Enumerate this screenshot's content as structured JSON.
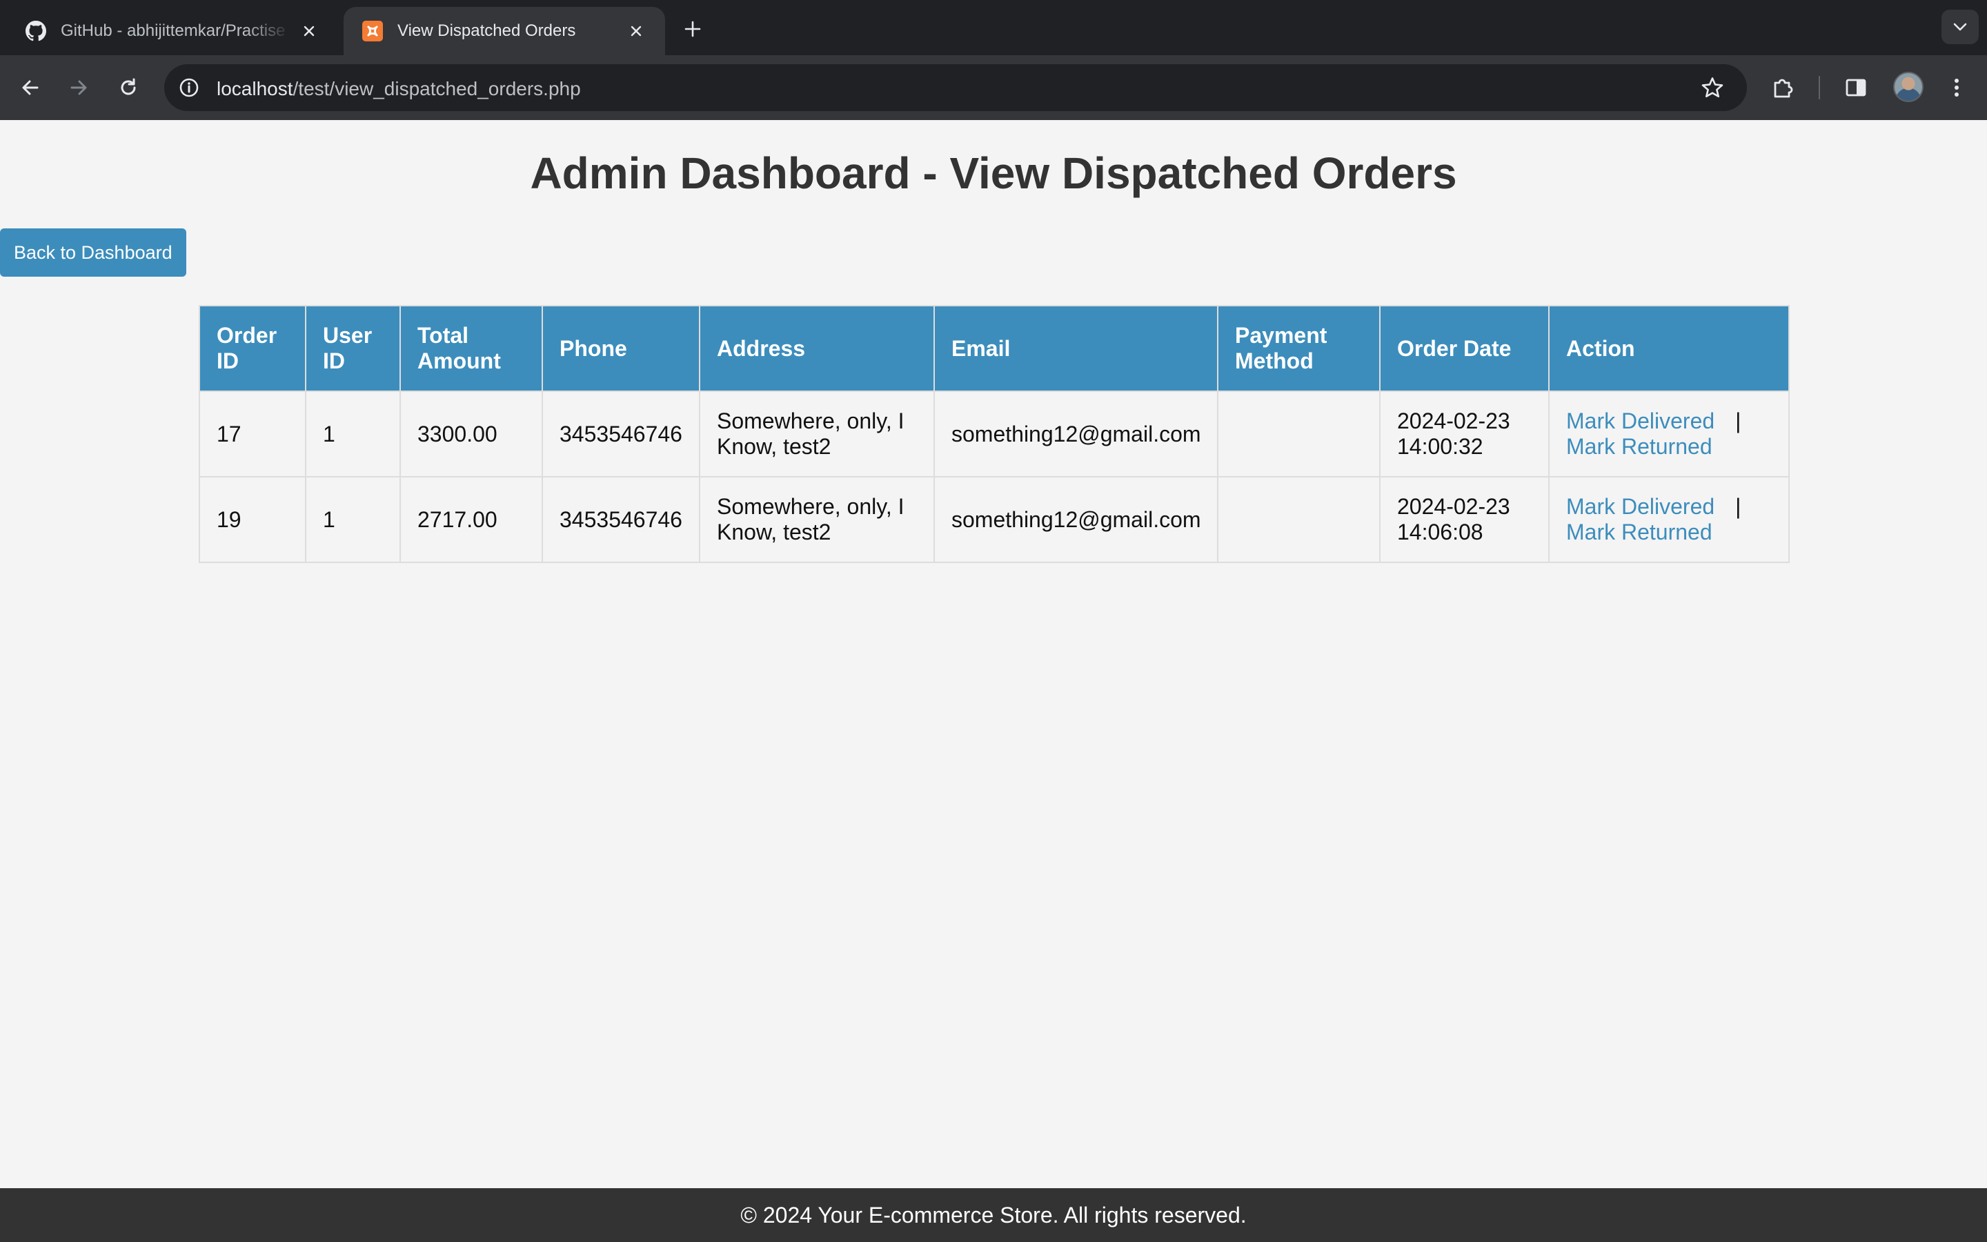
{
  "browser": {
    "tabs": [
      {
        "title": "GitHub - abhijittemkar/Practise",
        "favicon": "github-icon",
        "active": false
      },
      {
        "title": "View Dispatched Orders",
        "favicon": "xampp-icon",
        "active": true
      }
    ],
    "url": {
      "host": "localhost",
      "path": "/test/view_dispatched_orders.php"
    }
  },
  "page": {
    "title": "Admin Dashboard - View Dispatched Orders",
    "back_button": "Back to Dashboard"
  },
  "table": {
    "headers": [
      "Order ID",
      "User ID",
      "Total Amount",
      "Phone",
      "Address",
      "Email",
      "Payment Method",
      "Order Date",
      "Action"
    ],
    "rows": [
      {
        "order_id": "17",
        "user_id": "1",
        "total_amount": "3300.00",
        "phone": "3453546746",
        "address": "Somewhere, only, I Know, test2",
        "email": "something12@gmail.com",
        "payment_method": "",
        "order_date": "2024-02-23 14:00:32",
        "actions": {
          "delivered": "Mark Delivered",
          "separator": "|",
          "returned": "Mark Returned"
        }
      },
      {
        "order_id": "19",
        "user_id": "1",
        "total_amount": "2717.00",
        "phone": "3453546746",
        "address": "Somewhere, only, I Know, test2",
        "email": "something12@gmail.com",
        "payment_method": "",
        "order_date": "2024-02-23 14:06:08",
        "actions": {
          "delivered": "Mark Delivered",
          "separator": "|",
          "returned": "Mark Returned"
        }
      }
    ]
  },
  "footer": {
    "text": "© 2024 Your E-commerce Store. All rights reserved."
  },
  "colors": {
    "accent": "#3c8dbc",
    "page_background": "#f4f4f4",
    "footer_background": "#333333"
  }
}
